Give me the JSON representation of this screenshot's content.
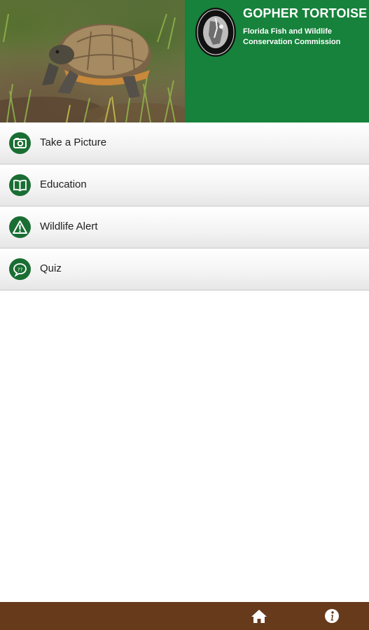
{
  "header": {
    "title": "GOPHER TORTOISE",
    "agency": "Florida Fish and Wildlife Conservation Commission",
    "seal_text": "FLORIDA FISH AND WILDLIFE CONSERVATION COMMISSION",
    "brand_color": "#16823b"
  },
  "menu": {
    "items": [
      {
        "label": "Take a Picture",
        "icon": "camera-icon"
      },
      {
        "label": "Education",
        "icon": "book-icon"
      },
      {
        "label": "Wildlife Alert",
        "icon": "alert-icon"
      },
      {
        "label": "Quiz",
        "icon": "quiz-bubble-icon"
      }
    ],
    "icon_color": "#1a6e33"
  },
  "footer": {
    "icons": [
      "home-icon",
      "info-icon"
    ],
    "background": "#673a1b"
  }
}
